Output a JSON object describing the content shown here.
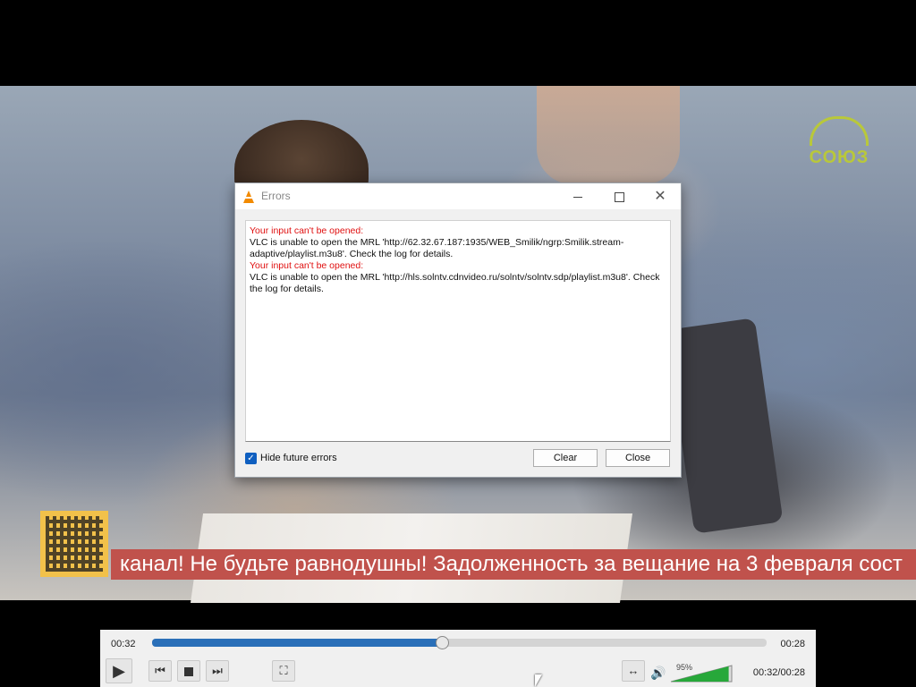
{
  "dialog": {
    "title": "Errors",
    "messages": [
      {
        "heading": "Your input can't be opened:",
        "body": "VLC is unable to open the MRL 'http://62.32.67.187:1935/WEB_Smilik/ngrp:Smilik.stream-adaptive/playlist.m3u8'. Check the log for details."
      },
      {
        "heading": "Your input can't be opened:",
        "body": "VLC is unable to open the MRL 'http://hls.solntv.cdnvideo.ru/solntv/solntv.sdp/playlist.m3u8'. Check the log for details."
      }
    ],
    "hide_future_errors_label": "Hide future errors",
    "hide_future_errors_checked": true,
    "clear_label": "Clear",
    "close_label": "Close"
  },
  "video": {
    "channel_logo_text": "СОЮЗ",
    "ticker_text": "канал! Не будьте равнодушны! Задолженность за вещание на 3 февраля сост"
  },
  "controls": {
    "time_elapsed": "00:32",
    "time_remaining": "00:28",
    "seek_progress": 0.47,
    "volume_label": "95%",
    "volume_level": 0.95,
    "total_time": "00:32/00:28"
  },
  "colors": {
    "error_red": "#e01010",
    "seek_blue": "#2a6fb8",
    "volume_green": "#27a83a",
    "ticker_red": "#c0524c",
    "logo_green": "#b9c83a"
  }
}
